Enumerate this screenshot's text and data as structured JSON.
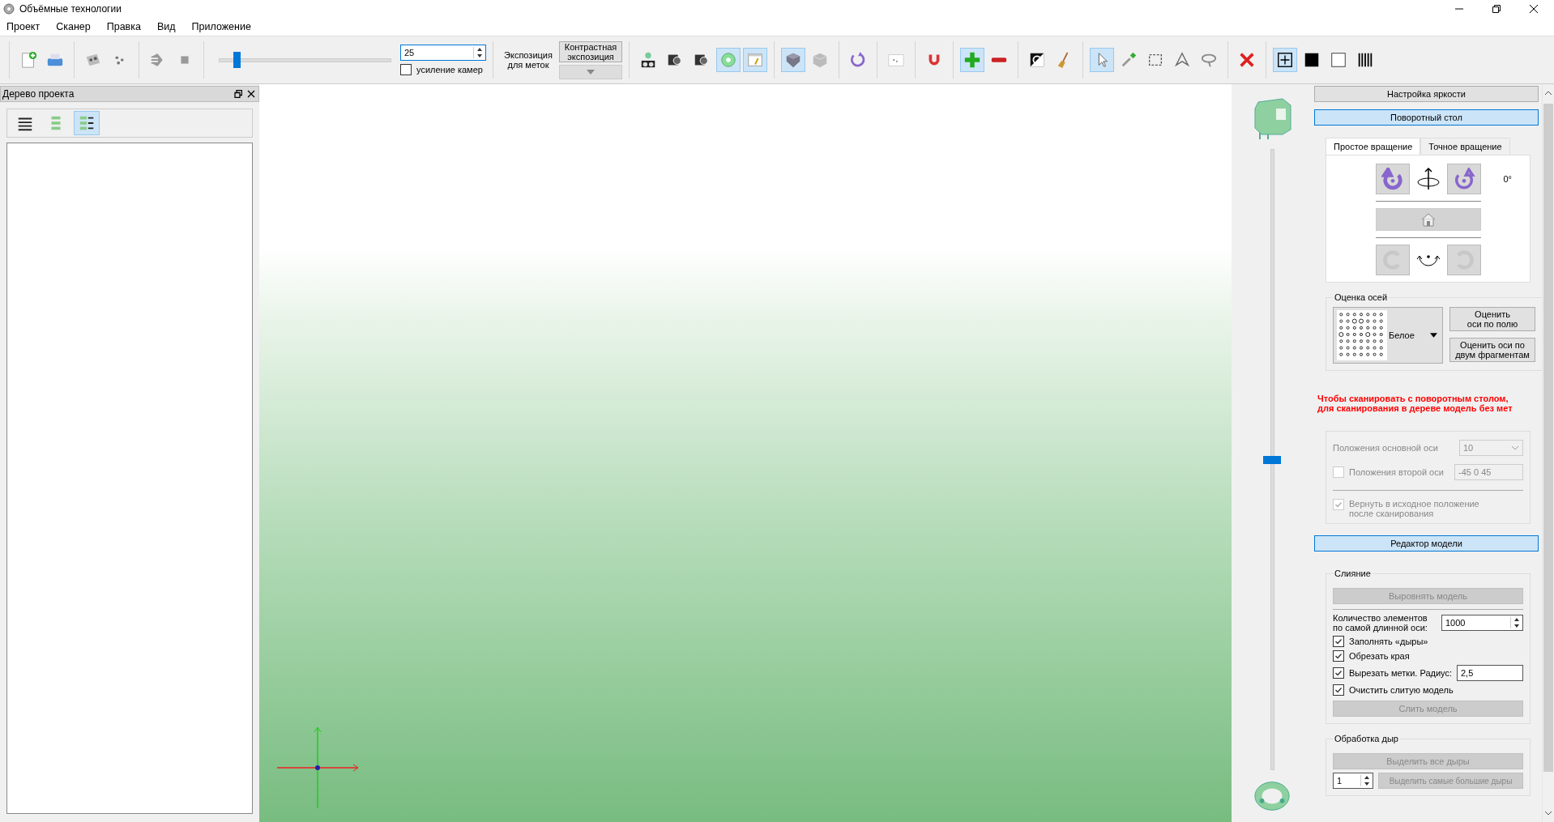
{
  "window": {
    "title": "Объёмные технологии"
  },
  "menu": [
    "Проект",
    "Сканер",
    "Правка",
    "Вид",
    "Приложение"
  ],
  "toolbar": {
    "groups_before": [
      [
        {
          "kind": "new-document",
          "selected": false
        },
        {
          "kind": "printer",
          "selected": false
        }
      ],
      [
        {
          "kind": "scanner-head",
          "selected": false
        },
        {
          "kind": "dots",
          "selected": false
        }
      ],
      [
        {
          "kind": "arrows",
          "selected": false
        },
        {
          "kind": "stop",
          "selected": false
        }
      ]
    ],
    "exposure": {
      "level": 0.1,
      "value": "25",
      "gain": {
        "label": "усиление камер",
        "checked": false
      },
      "label": "Экспозиция для меток",
      "contrast_button": "Контрастная экспозиция"
    },
    "groups_after": [
      [
        {
          "kind": "cameras",
          "selected": false
        },
        {
          "kind": "camera",
          "selected": false
        },
        {
          "kind": "camera",
          "selected": false
        },
        {
          "kind": "wheel",
          "selected": true
        },
        {
          "kind": "window-edit",
          "selected": true
        }
      ],
      [
        {
          "kind": "cube-dark",
          "selected": true
        },
        {
          "kind": "cube-light",
          "selected": false
        }
      ],
      [
        {
          "kind": "rotate",
          "selected": false
        }
      ],
      [
        {
          "kind": "dots-window",
          "selected": false
        }
      ],
      [
        {
          "kind": "magnet",
          "selected": false
        }
      ],
      [
        {
          "kind": "plus",
          "selected": true
        },
        {
          "kind": "minus",
          "selected": false
        }
      ],
      [
        {
          "kind": "contrast",
          "selected": false
        },
        {
          "kind": "broom",
          "selected": false
        }
      ],
      [
        {
          "kind": "pointer",
          "selected": true
        },
        {
          "kind": "pipette",
          "selected": false
        },
        {
          "kind": "rect-select",
          "selected": false
        },
        {
          "kind": "polygon-select",
          "selected": false
        },
        {
          "kind": "lasso",
          "selected": false
        }
      ],
      [
        {
          "kind": "delete",
          "selected": false
        }
      ],
      [
        {
          "kind": "fit",
          "selected": true
        },
        {
          "kind": "black-square",
          "selected": false
        },
        {
          "kind": "white-square",
          "selected": false
        },
        {
          "kind": "barcode",
          "selected": false
        }
      ]
    ]
  },
  "project_tree": {
    "title": "Дерево проекта",
    "views": [
      {
        "kind": "lines",
        "selected": false
      },
      {
        "kind": "blocks",
        "selected": false
      },
      {
        "kind": "blocks-lines",
        "selected": true
      }
    ]
  },
  "viewport": {
    "zoom_slider": {
      "level": 0.5
    }
  },
  "right_panel": {
    "brightness": {
      "title": "Настройка яркости",
      "selected": false
    },
    "turntable": {
      "title": "Поворотный стол",
      "selected": true,
      "tabs": [
        {
          "label": "Простое вращение",
          "selected": true
        },
        {
          "label": "Точное вращение",
          "selected": false
        }
      ],
      "top_buttons": [
        {
          "kind": "rotate-ccw",
          "disabled": false
        },
        {
          "kind": "rotate-cw",
          "disabled": false
        }
      ],
      "angle": "0°",
      "home_disabled": true,
      "bottom_buttons": [
        {
          "kind": "tilt-back",
          "disabled": true
        },
        {
          "kind": "tilt-forward",
          "disabled": true
        }
      ],
      "axes": {
        "title": "Оценка осей",
        "pattern": "Белое",
        "buttons": [
          "Оценить\nоси по полю",
          "Оценить оси по\nдвум фрагментам"
        ]
      },
      "warning": [
        "Чтобы сканировать с поворотным столом,",
        "для сканирования в дереве модель без мет"
      ],
      "main_axis": {
        "label": "Положения основной оси",
        "value": "10"
      },
      "second_axis": {
        "label": "Положения второй оси",
        "checked": false,
        "value": "-45 0 45"
      },
      "return_home": {
        "label": "Вернуть в исходное положение после сканирования",
        "checked": true
      }
    },
    "model_editor": {
      "title": "Редактор модели",
      "selected": true,
      "merge": {
        "title": "Слияние",
        "align_button": "Выровнять модель",
        "count_label": "Количество элементов по самой длинной оси:",
        "count": "1000",
        "options": [
          {
            "label": "Заполнять «дыры»",
            "checked": true
          },
          {
            "label": "Обрезать края",
            "checked": true
          },
          {
            "label": "Вырезать метки. Радиус:",
            "checked": true,
            "value": "2,5"
          },
          {
            "label": "Очистить слитую модель",
            "checked": true
          }
        ],
        "merge_button": "Слить модель"
      },
      "holes": {
        "title": "Обработка дыр",
        "select_all_button": "Выделить все дыры",
        "count": "1",
        "select_largest_button": "Выделить самые большие дыры"
      }
    }
  }
}
